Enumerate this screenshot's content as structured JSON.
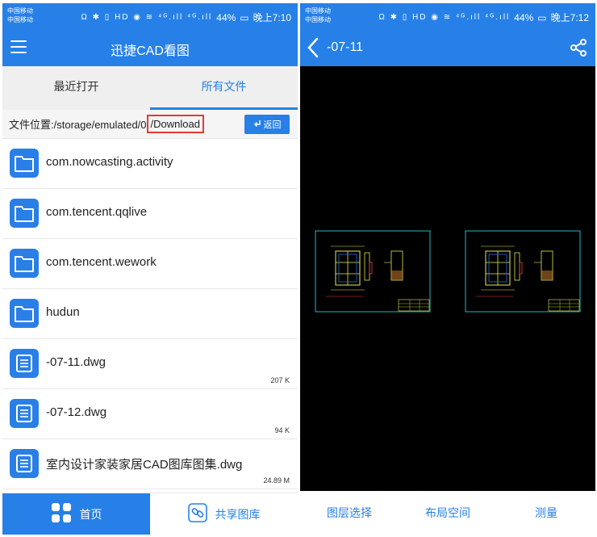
{
  "colors": {
    "primary": "#2680e8",
    "highlight_border": "#e53935",
    "canvas": "#000000"
  },
  "left_screen": {
    "status": {
      "carrier1": "中国移动",
      "carrier2": "中国移动",
      "battery": "44%",
      "time": "晚上7:10",
      "icons": "Ω ✱ ▯ HD ◉ ≋ ⁴ᴳ.ıll ⁴ᴳ.ıll"
    },
    "header": {
      "title": "迅捷CAD看图",
      "menu_icon": "menu-icon"
    },
    "tabs": [
      {
        "label": "最近打开",
        "active": false
      },
      {
        "label": "所有文件",
        "active": true
      }
    ],
    "path": {
      "prefix": "文件位置:/storage/emulated/0",
      "highlighted": "/Download"
    },
    "back_button": {
      "label": "返回",
      "icon": "return-arrow-icon"
    },
    "files": [
      {
        "name": "com.nowcasting.activity",
        "type": "folder",
        "size": ""
      },
      {
        "name": "com.tencent.qqlive",
        "type": "folder",
        "size": ""
      },
      {
        "name": "com.tencent.wework",
        "type": "folder",
        "size": ""
      },
      {
        "name": "hudun",
        "type": "folder",
        "size": ""
      },
      {
        "name": "-07-11.dwg",
        "type": "dwg",
        "size": "207 K"
      },
      {
        "name": "-07-12.dwg",
        "type": "dwg",
        "size": "94 K"
      },
      {
        "name": "室内设计家装家居CAD图库图集.dwg",
        "type": "dwg",
        "size": "24.89 M"
      }
    ],
    "bottom_nav": [
      {
        "label": "首页",
        "icon": "home-grid-icon",
        "active": true
      },
      {
        "label": "共享图库",
        "icon": "link-icon",
        "active": false
      }
    ]
  },
  "right_screen": {
    "status": {
      "carrier1": "中国移动",
      "carrier2": "中国移动",
      "battery": "44%",
      "time": "晚上7:12",
      "icons": "Ω ✱ ▯ HD ◉ ≋ ⁴ᴳ.ıll ⁴ᴳ.ıll"
    },
    "header": {
      "title": "-07-11",
      "back_icon": "chevron-left-icon",
      "share_icon": "share-icon"
    },
    "toolbar": [
      {
        "label": "图层选择"
      },
      {
        "label": "布局空间"
      },
      {
        "label": "测量"
      }
    ]
  }
}
